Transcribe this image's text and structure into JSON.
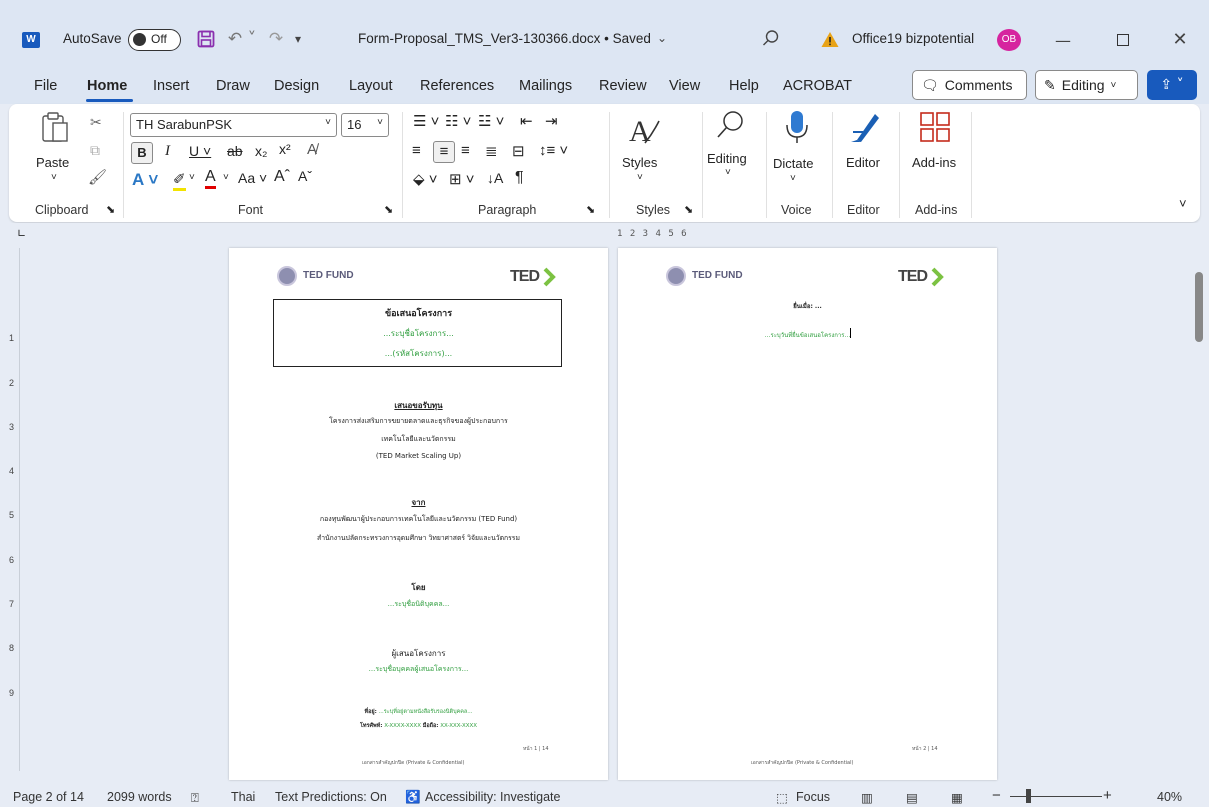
{
  "titlebar": {
    "autosave_label": "AutoSave",
    "autosave_state": "Off",
    "document_title": "Form-Proposal_TMS_Ver3-130366.docx • Saved",
    "user_name": "Office19 bizpotential",
    "user_initials": "OB"
  },
  "menu": [
    "File",
    "Home",
    "Insert",
    "Draw",
    "Design",
    "Layout",
    "References",
    "Mailings",
    "Review",
    "View",
    "Help",
    "ACROBAT"
  ],
  "actions": {
    "comments": "Comments",
    "editing": "Editing"
  },
  "ribbon": {
    "paste": "Paste",
    "font_name": "TH SarabunPSK",
    "font_size": "16",
    "styles": "Styles",
    "editing": "Editing",
    "dictate": "Dictate",
    "editor": "Editor",
    "addins": "Add-ins",
    "groups": {
      "clipboard": "Clipboard",
      "font": "Font",
      "paragraph": "Paragraph",
      "styles": "Styles",
      "voice": "Voice",
      "editor": "Editor",
      "addins": "Add-ins"
    }
  },
  "ruler": {
    "marks": "1 2 3 4 5 6"
  },
  "vruler_marks": [
    "1",
    "2",
    "3",
    "4",
    "5",
    "6",
    "7",
    "8",
    "9"
  ],
  "page1": {
    "logo_left": "TED FUND",
    "logo_right": "TED",
    "box_title": "ข้อเสนอโครงการ",
    "box_line1": "...ระบุชื่อโครงการ...",
    "box_line2": "...(รหัสโครงการ)...",
    "section_title": "เสนอขอรับทุน",
    "program_line1": "โครงการส่งเสริมการขยายตลาดและธุรกิจของผู้ประกอบการ",
    "program_line2": "เทคโนโลยีและนวัตกรรม",
    "program_line3": "(TED Market Scaling Up)",
    "from_title": "จาก",
    "from_line1": "กองทุนพัฒนาผู้ประกอบการเทคโนโลยีและนวัตกรรม (TED Fund)",
    "from_line2": "สำนักงานปลัดกระทรวงการอุดมศึกษา วิทยาศาสตร์ วิจัยและนวัตกรรม",
    "by_title": "โดย",
    "by_value": "...ระบุชื่อนิติบุคคล...",
    "proposer_title": "ผู้เสนอโครงการ",
    "proposer_value": "...ระบุชื่อบุคคลผู้เสนอโครงการ...",
    "address_label": "ที่อยู่:",
    "address_value": "...ระบุที่อยู่ตามหนังสือรับรองนิติบุคคล...",
    "phone_label": "โทรศัพท์:",
    "phone_value": "X-XXXX-XXXX",
    "mobile_label": "มือถือ:",
    "mobile_value": "XX-XXX-XXXX",
    "page_number": "หน้า 1 | 14",
    "confidential": "เอกสารสำคัญปกปิด (Private & Confidential)"
  },
  "page2": {
    "logo_left": "TED FUND",
    "logo_right": "TED",
    "date_line": "ยื่นเมื่อ: ...",
    "date_value": "...ระบุวันที่ยื่นข้อเสนอโครงการ...",
    "page_number": "หน้า 2 | 14",
    "confidential": "เอกสารสำคัญปกปิด (Private & Confidential)"
  },
  "status": {
    "page": "Page 2 of 14",
    "words": "2099 words",
    "language": "Thai",
    "predictions": "Text Predictions: On",
    "accessibility": "Accessibility: Investigate",
    "focus": "Focus",
    "zoom": "40%"
  }
}
